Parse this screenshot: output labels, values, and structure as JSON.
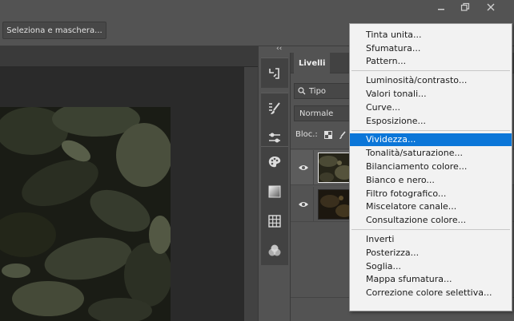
{
  "window": {
    "minimize_icon": "minimize-icon",
    "maximize_icon": "restore-icon",
    "close_icon": "close-icon"
  },
  "options_bar": {
    "select_and_mask_label": "Seleziona e maschera..."
  },
  "icon_strip": {
    "collapse_label": "‹‹",
    "icons": [
      "history-icon",
      "brush-settings-icon",
      "adjustments-icon",
      "palette-icon",
      "gradient-icon",
      "grid-icon",
      "channels-icon"
    ]
  },
  "layers_panel": {
    "tab_label": "Livelli",
    "kind_filter": {
      "icon": "search-icon",
      "value": "Tipo"
    },
    "blend_mode": "Normale",
    "lock_label": "Bloc.:",
    "layers": [
      {
        "visible": true,
        "selected": true,
        "thumb": "photo-thumb-1"
      },
      {
        "visible": true,
        "selected": false,
        "thumb": "photo-thumb-2"
      }
    ]
  },
  "adjustment_menu": {
    "groups": [
      [
        "Tinta unita...",
        "Sfumatura...",
        "Pattern..."
      ],
      [
        "Luminosità/contrasto...",
        "Valori tonali...",
        "Curve...",
        "Esposizione..."
      ],
      [
        "Vividezza...",
        "Tonalità/saturazione...",
        "Bilanciamento colore...",
        "Bianco e nero...",
        "Filtro fotografico...",
        "Miscelatore canale...",
        "Consultazione colore..."
      ],
      [
        "Inverti",
        "Posterizza...",
        "Soglia...",
        "Mappa sfumatura...",
        "Correzione colore selettiva..."
      ]
    ],
    "highlighted": "Vividezza...",
    "highlight_color": "#0b76d8"
  }
}
